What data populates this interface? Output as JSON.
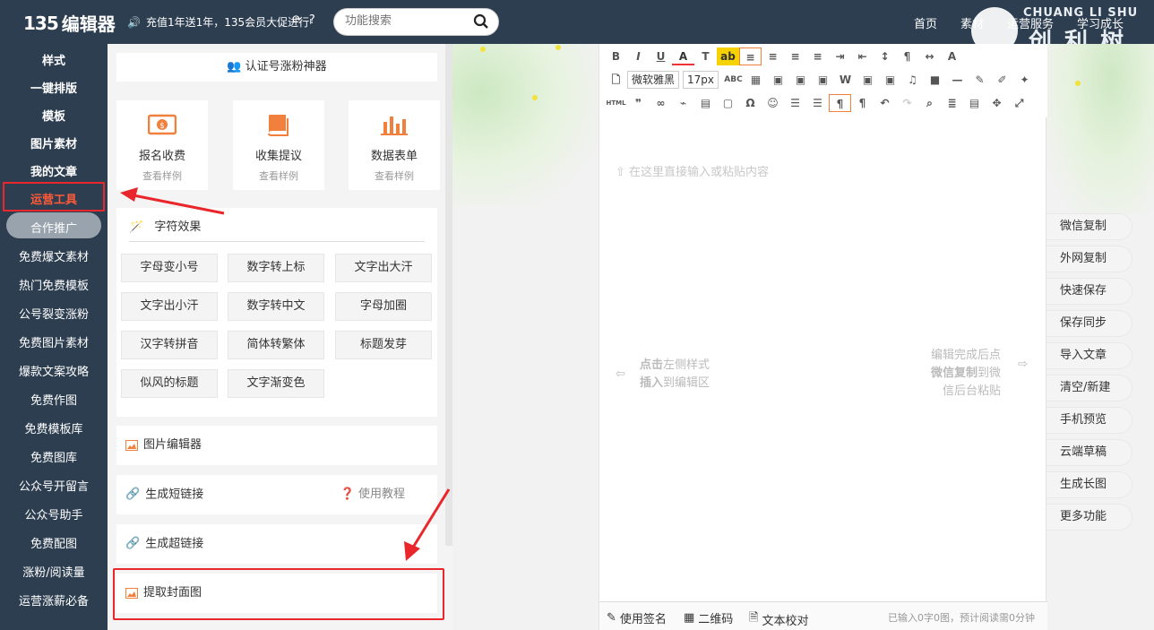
{
  "header": {
    "logo_num": "135",
    "logo_text": "编辑器",
    "promo": "充值1年送1年，135会员大促进行中",
    "search_placeholder": "功能搜索",
    "nav": [
      "首页",
      "素材",
      "运营服务",
      "学习成长"
    ],
    "watermark_en": "CHUANG LI SHU",
    "watermark_cn": "创利树"
  },
  "sidebar": {
    "items": [
      "样式",
      "一键排版",
      "模板",
      "图片素材",
      "我的文章",
      "运营工具",
      "合作推广",
      "免费爆文素材",
      "热门免费模板",
      "公号裂变涨粉",
      "免费图片素材",
      "爆款文案攻略",
      "免费作图",
      "免费模板库",
      "免费图库",
      "公众号开留言",
      "公众号助手",
      "免费配图",
      "涨粉/阅读量",
      "运营涨薪必备"
    ],
    "active_index": 5
  },
  "panel": {
    "banner": "认证号涨粉神器",
    "tools": [
      {
        "title": "报名收费",
        "sub": "查看样例"
      },
      {
        "title": "收集提议",
        "sub": "查看样例"
      },
      {
        "title": "数据表单",
        "sub": "查看样例"
      }
    ],
    "effects_title": "字符效果",
    "effects": [
      "字母变小号",
      "数字转上标",
      "文字出大汗",
      "文字出小汗",
      "数字转中文",
      "字母加圈",
      "汉字转拼音",
      "简体转繁体",
      "标题发芽",
      "似风的标题",
      "文字渐变色"
    ],
    "rows": {
      "image_editor": "图片编辑器",
      "short_link": "生成短链接",
      "tutorial": "使用教程",
      "hyperlink": "生成超链接",
      "cover": "提取封面图"
    }
  },
  "editor": {
    "font_family": "微软雅黑",
    "font_size": "17px",
    "placeholder": "在这里直接输入或粘贴内容",
    "hint_left_1a": "点击",
    "hint_left_1b": "左侧样式",
    "hint_left_2a": "插入",
    "hint_left_2b": "到编辑区",
    "hint_right_1": "编辑完成后点",
    "hint_right_2a": "微信复制",
    "hint_right_2b": "到微",
    "hint_right_3": "信后台粘贴",
    "status": {
      "signature": "使用签名",
      "qrcode": "二维码",
      "proofread": "文本校对",
      "count": "已输入0字0图，预计阅读需0分钟"
    }
  },
  "right_buttons": [
    "微信复制",
    "外网复制",
    "快速保存",
    "保存同步",
    "导入文章",
    "清空/新建",
    "手机预览",
    "云端草稿",
    "生成长图",
    "更多功能"
  ],
  "colors": {
    "topbar": "#2d3e50",
    "accent_red": "#e8262b",
    "active_text": "#ff5a38",
    "icon_orange": "#f0803c"
  }
}
